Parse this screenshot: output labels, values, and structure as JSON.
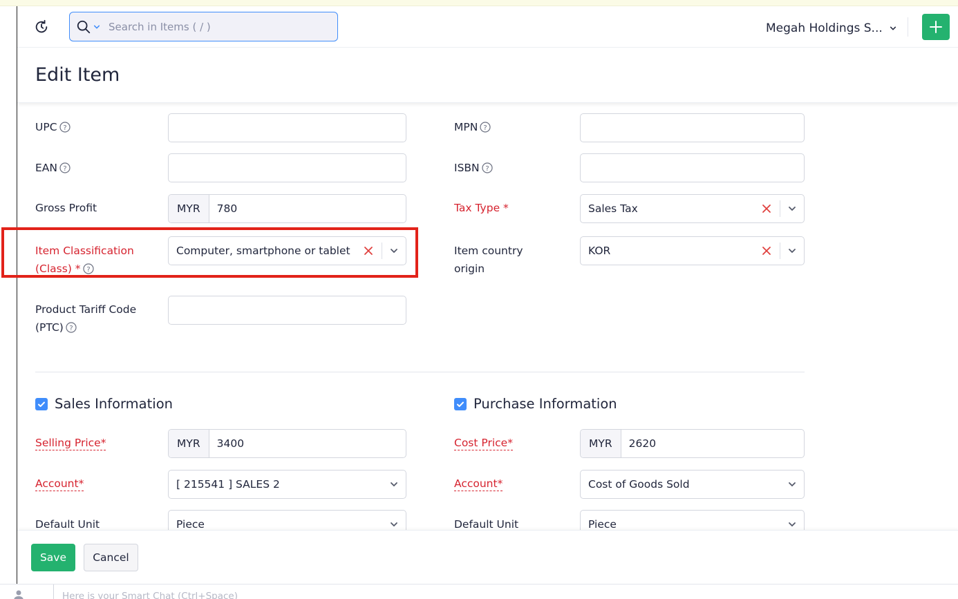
{
  "header": {
    "search_placeholder": "Search in Items ( / )",
    "org_name": "Megah Holdings S..."
  },
  "page": {
    "title": "Edit Item"
  },
  "form": {
    "upc": {
      "label": "UPC",
      "value": ""
    },
    "mpn": {
      "label": "MPN",
      "value": ""
    },
    "ean": {
      "label": "EAN",
      "value": ""
    },
    "isbn": {
      "label": "ISBN",
      "value": ""
    },
    "gross_profit": {
      "label": "Gross Profit",
      "currency": "MYR",
      "value": "780"
    },
    "tax_type": {
      "label": "Tax Type *",
      "value": "Sales Tax"
    },
    "item_classification": {
      "label_line1": "Item Classification",
      "label_line2": "(Class) *",
      "value": "Computer, smartphone or tablet"
    },
    "country_origin": {
      "label_line1": "Item country",
      "label_line2": "origin",
      "value": "KOR"
    },
    "ptc": {
      "label_line1": "Product Tariff Code",
      "label_line2": "(PTC)",
      "value": ""
    }
  },
  "sales": {
    "heading": "Sales Information",
    "selling_price_label": "Selling Price*",
    "currency": "MYR",
    "selling_price": "3400",
    "account_label": "Account*",
    "account_value": "[ 215541 ] SALES 2",
    "unit_label": "Default Unit",
    "unit_value": "Piece"
  },
  "purchase": {
    "heading": "Purchase Information",
    "cost_price_label": "Cost Price*",
    "currency": "MYR",
    "cost_price": "2620",
    "account_label": "Account*",
    "account_value": "Cost of Goods Sold",
    "unit_label": "Default Unit",
    "unit_value": "Piece"
  },
  "footer": {
    "save_label": "Save",
    "cancel_label": "Cancel"
  },
  "chat": {
    "placeholder": "Here is your Smart Chat (Ctrl+Space)"
  },
  "colors": {
    "accent": "#408dfb",
    "primary_green": "#24b26f",
    "required_red": "#d6232f",
    "highlight": "#e2231a"
  }
}
